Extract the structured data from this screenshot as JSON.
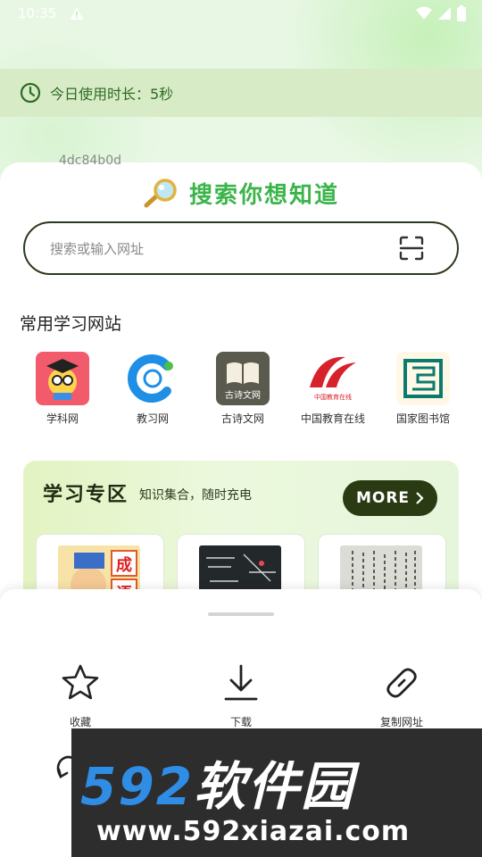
{
  "status_bar": {
    "time": "10:35"
  },
  "usage": {
    "text": "今日使用时长：5秒"
  },
  "hash_text": "4dc84b0d",
  "search": {
    "title": "搜索你想知道",
    "placeholder": "搜索或输入网址"
  },
  "common_sites": {
    "title": "常用学习网站",
    "items": [
      {
        "label": "学科网",
        "icon": "cartoon-scholar-icon"
      },
      {
        "label": "教习网",
        "icon": "blue-letter-c-icon"
      },
      {
        "label": "古诗文网",
        "icon": "book-icon",
        "icon_text": "古诗文网"
      },
      {
        "label": "中国教育在线",
        "icon": "red-logo-icon",
        "icon_text": "中国教育在线"
      },
      {
        "label": "国家图书馆",
        "icon": "seal-icon"
      }
    ]
  },
  "study_zone": {
    "title": "学习专区",
    "subtitle": "知识集合，随时充电",
    "more_label": "MORE",
    "thumb1_text": [
      "成",
      "语"
    ]
  },
  "sheet_actions": [
    {
      "label": "收藏",
      "icon": "star-icon"
    },
    {
      "label": "下载",
      "icon": "download-icon"
    },
    {
      "label": "复制网址",
      "icon": "link-icon"
    }
  ],
  "watermark": {
    "brand_num": "592",
    "brand_cn": "软件园",
    "url": "www.592xiazai.com"
  },
  "colors": {
    "accent": "#3bb54a",
    "dark": "#2a3a13",
    "usage_bg": "#d7ecc6"
  }
}
